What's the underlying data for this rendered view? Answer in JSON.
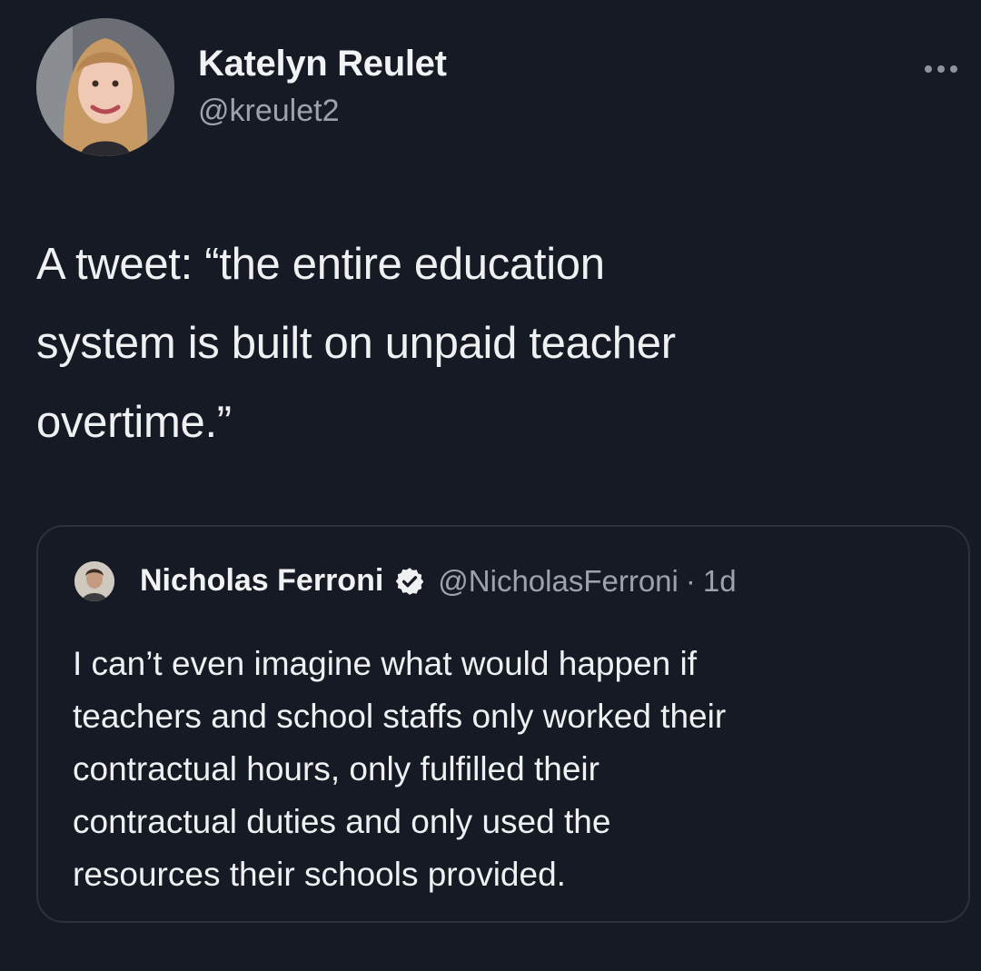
{
  "tweet": {
    "author_name": "Katelyn Reulet",
    "author_handle": "@kreulet2",
    "text_lines": [
      "A tweet: “the entire education",
      "system is built on unpaid teacher",
      "overtime.”"
    ]
  },
  "quoted_tweet": {
    "author_name": "Nicholas Ferroni",
    "author_handle": "@NicholasFerroni",
    "separator": "·",
    "time": "1d",
    "verified": true,
    "text_lines": [
      "I can’t even imagine what would happen if",
      "teachers and school staffs only worked their",
      "contractual hours, only fulfilled their",
      "contractual duties and only used the",
      "resources their schools provided."
    ]
  },
  "icons": {
    "more": "more-options-icon",
    "verified": "verified-badge-icon"
  },
  "colors": {
    "background": "#161a25",
    "text_primary": "#eef0f2",
    "text_secondary": "#9ea3aa",
    "card_border": "#2c313b"
  }
}
